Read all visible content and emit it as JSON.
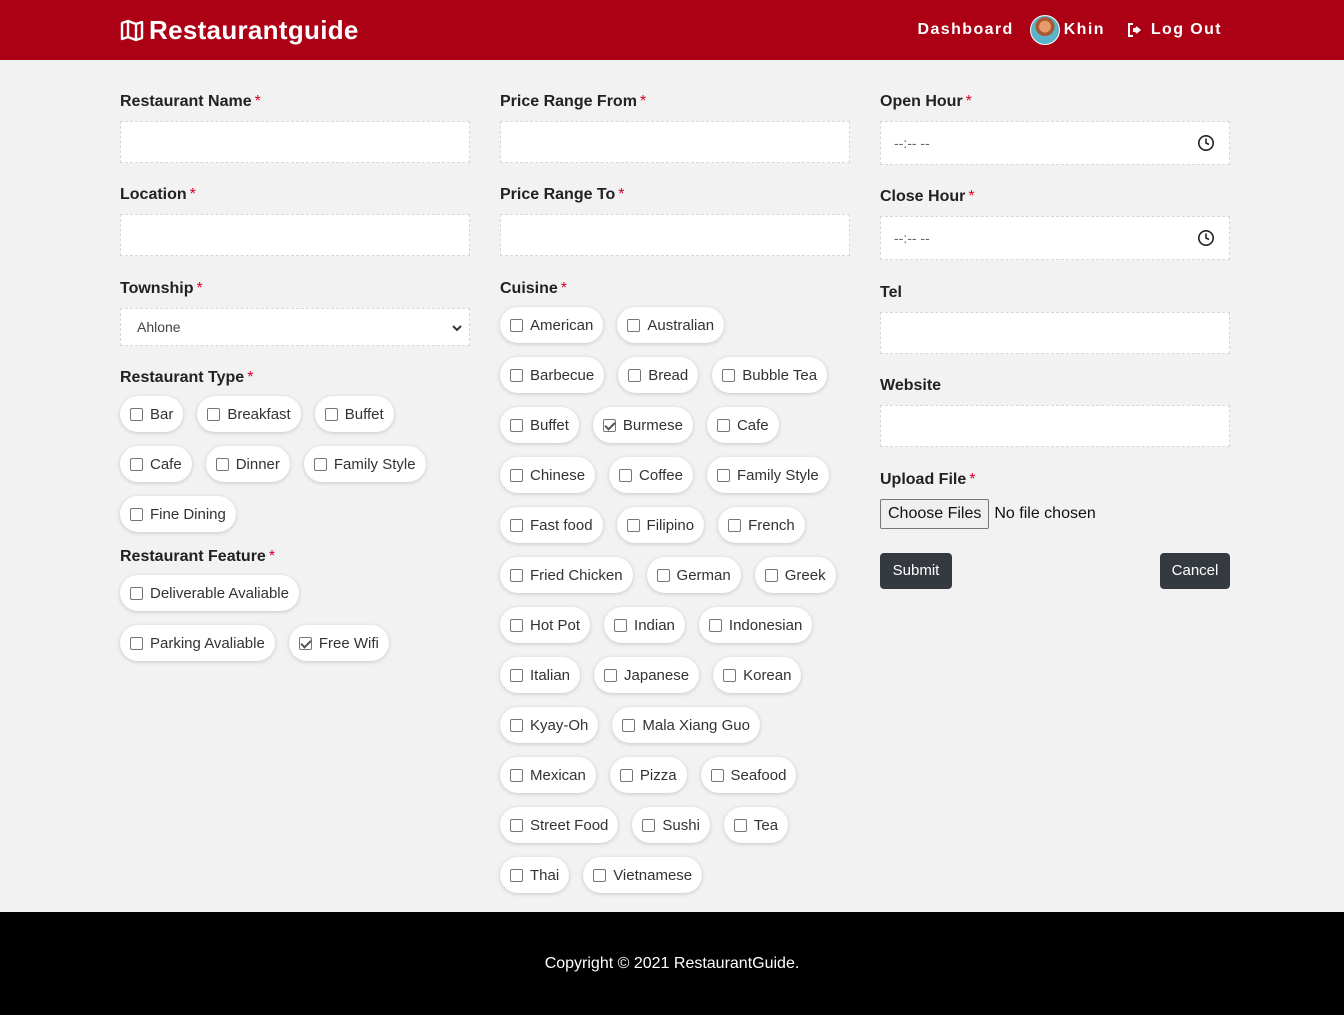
{
  "nav": {
    "brand_main": "Restaurant",
    "brand_g": "g",
    "brand_rest": "uide",
    "dashboard": "Dashboard",
    "user_name": "Khin",
    "logout": "Log Out"
  },
  "form": {
    "restaurant_name": {
      "label": "Restaurant Name",
      "req": "*"
    },
    "location": {
      "label": "Location",
      "req": "*"
    },
    "township": {
      "label": "Township",
      "req": "*",
      "value": "Ahlone"
    },
    "restaurant_type": {
      "label": "Restaurant Type",
      "req": "*",
      "options": [
        {
          "label": "Bar",
          "checked": false
        },
        {
          "label": "Breakfast",
          "checked": false
        },
        {
          "label": "Buffet",
          "checked": false
        },
        {
          "label": "Cafe",
          "checked": false
        },
        {
          "label": "Dinner",
          "checked": false
        },
        {
          "label": "Family Style",
          "checked": false
        },
        {
          "label": "Fine Dining",
          "checked": false
        }
      ]
    },
    "restaurant_feature": {
      "label": "Restaurant Feature",
      "req": "*",
      "options": [
        {
          "label": "Deliverable Avaliable",
          "checked": false
        },
        {
          "label": "Parking Avaliable",
          "checked": false
        },
        {
          "label": "Free Wifi",
          "checked": true
        }
      ]
    },
    "price_from": {
      "label": "Price Range From",
      "req": "*"
    },
    "price_to": {
      "label": "Price Range To",
      "req": "*"
    },
    "cuisine": {
      "label": "Cuisine",
      "req": "*",
      "options": [
        {
          "label": "American",
          "checked": false
        },
        {
          "label": "Australian",
          "checked": false
        },
        {
          "label": "Barbecue",
          "checked": false
        },
        {
          "label": "Bread",
          "checked": false
        },
        {
          "label": "Bubble Tea",
          "checked": false
        },
        {
          "label": "Buffet",
          "checked": false
        },
        {
          "label": "Burmese",
          "checked": true
        },
        {
          "label": "Cafe",
          "checked": false
        },
        {
          "label": "Chinese",
          "checked": false
        },
        {
          "label": "Coffee",
          "checked": false
        },
        {
          "label": "Family Style",
          "checked": false
        },
        {
          "label": "Fast food",
          "checked": false
        },
        {
          "label": "Filipino",
          "checked": false
        },
        {
          "label": "French",
          "checked": false
        },
        {
          "label": "Fried Chicken",
          "checked": false
        },
        {
          "label": "German",
          "checked": false
        },
        {
          "label": "Greek",
          "checked": false
        },
        {
          "label": "Hot Pot",
          "checked": false
        },
        {
          "label": "Indian",
          "checked": false
        },
        {
          "label": "Indonesian",
          "checked": false
        },
        {
          "label": "Italian",
          "checked": false
        },
        {
          "label": "Japanese",
          "checked": false
        },
        {
          "label": "Korean",
          "checked": false
        },
        {
          "label": "Kyay-Oh",
          "checked": false
        },
        {
          "label": "Mala Xiang Guo",
          "checked": false
        },
        {
          "label": "Mexican",
          "checked": false
        },
        {
          "label": "Pizza",
          "checked": false
        },
        {
          "label": "Seafood",
          "checked": false
        },
        {
          "label": "Street Food",
          "checked": false
        },
        {
          "label": "Sushi",
          "checked": false
        },
        {
          "label": "Tea",
          "checked": false
        },
        {
          "label": "Thai",
          "checked": false
        },
        {
          "label": "Vietnamese",
          "checked": false
        }
      ]
    },
    "open_hour": {
      "label": "Open Hour",
      "req": "*",
      "placeholder": "--:-- --"
    },
    "close_hour": {
      "label": "Close Hour",
      "req": "*",
      "placeholder": "--:-- --"
    },
    "tel": {
      "label": "Tel"
    },
    "website": {
      "label": "Website"
    },
    "upload": {
      "label": "Upload File",
      "req": "*",
      "button": "Choose Files",
      "status": "No file chosen"
    },
    "submit": "Submit",
    "cancel": "Cancel"
  },
  "footer": {
    "text": "Copyright © 2021 RestaurantGuide."
  },
  "colors": {
    "brand": "#ac0014",
    "required": "#d9002b",
    "button": "#343a40",
    "footer": "#000000"
  }
}
